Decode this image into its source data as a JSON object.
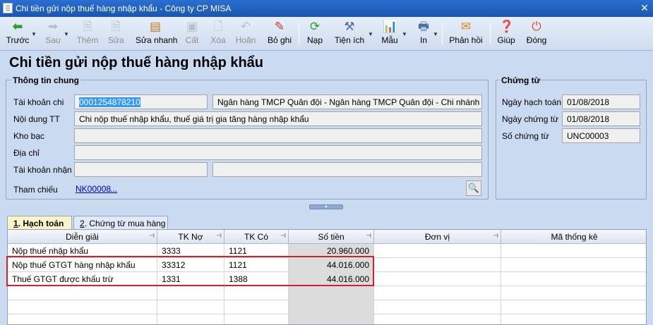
{
  "window": {
    "title": "Chi tiền gửi nộp thuế hàng nhập khẩu - Công ty CP MISA",
    "close_glyph": "✕"
  },
  "toolbar": {
    "back": "Trước",
    "next": "Sau",
    "add": "Thêm",
    "edit": "Sửa",
    "quick_edit": "Sửa nhanh",
    "save": "Cất",
    "delete": "Xóa",
    "undo": "Hoãn",
    "discard": "Bỏ ghi",
    "load": "Nạp",
    "utilities": "Tiện ích",
    "template": "Mẫu",
    "print": "In",
    "feedback": "Phản hồi",
    "help": "Giúp",
    "close": "Đóng"
  },
  "page": {
    "title": "Chi tiền gửi nộp thuế hàng nhập khẩu"
  },
  "general": {
    "title": "Thông tin chung",
    "account_label": "Tài khoản chi",
    "account_value": "0001254878210",
    "bank_name": "Ngân hàng TMCP Quân đội  - Ngân hàng TMCP Quân đội - Chi nhánh Th",
    "content_label": "Nội dung TT",
    "content_value": "Chi nộp thuế nhập khẩu, thuế giá trị gia tăng hàng nhập khẩu",
    "treasury_label": "Kho bạc",
    "treasury_value": "",
    "address_label": "Địa chỉ",
    "address_value": "",
    "receive_account_label": "Tài khoản nhận",
    "receive_account_value": "",
    "receive_bank_value": "",
    "reference_label": "Tham chiếu",
    "reference_value": "NK00008",
    "reference_more": "..."
  },
  "voucher": {
    "title": "Chứng từ",
    "posting_date_label": "Ngày hạch toán",
    "posting_date": "01/08/2018",
    "voucher_date_label": "Ngày chứng từ",
    "voucher_date": "01/08/2018",
    "voucher_no_label": "Số chứng từ",
    "voucher_no": "UNC00003"
  },
  "tabs": [
    {
      "key": "1",
      "rest": ". Hạch toán"
    },
    {
      "key": "2",
      "rest": ". Chứng từ mua hàng"
    }
  ],
  "grid": {
    "columns": [
      "Diễn giải",
      "TK Nợ",
      "TK Có",
      "Số tiền",
      "Đơn vị",
      "Mã thống kê"
    ],
    "rows": [
      [
        "Nộp thuế nhập khẩu",
        "3333",
        "1121",
        "20.960.000",
        "",
        ""
      ],
      [
        "Nộp thuế GTGT hàng nhập khẩu",
        "33312",
        "1121",
        "44.016.000",
        "",
        ""
      ],
      [
        "Thuế GTGT được khấu trừ",
        "1331",
        "1388",
        "44.016.000",
        "",
        ""
      ]
    ]
  },
  "colors": {
    "highlight": "#d0202a",
    "titlebar": "#1b56b0",
    "background": "#c9daf1"
  }
}
